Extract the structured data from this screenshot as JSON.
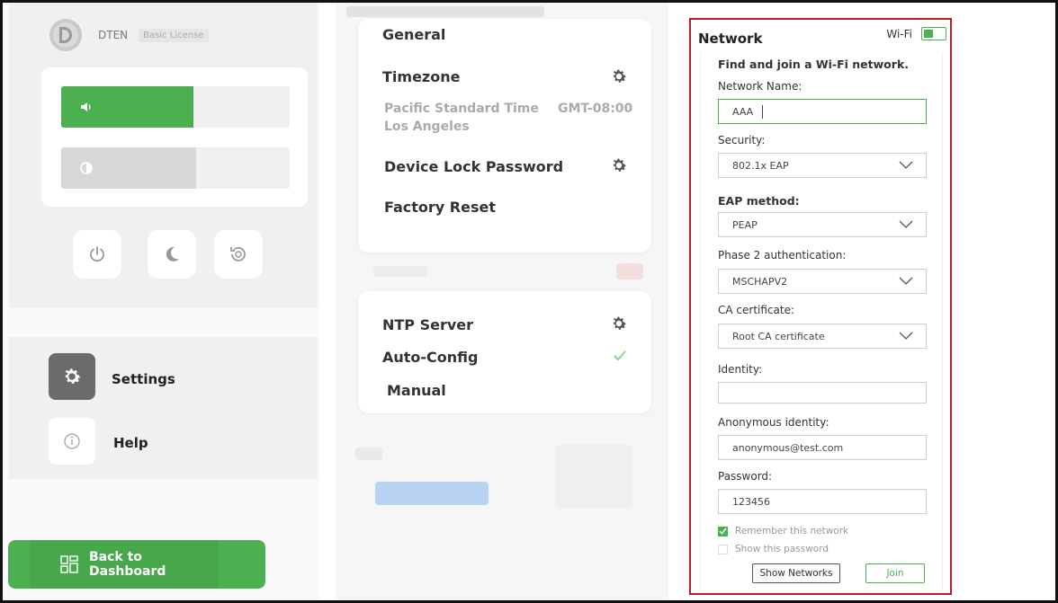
{
  "sidebar": {
    "brand": "DTEN",
    "license": "Basic License",
    "volume_level": 0.58,
    "brightness_level": 0.59,
    "nav": {
      "settings_label": "Settings",
      "help_label": "Help"
    },
    "back_label": "Back to Dashboard"
  },
  "middle": {
    "general": {
      "title": "General",
      "timezone_title": "Timezone",
      "timezone_name": "Pacific Standard Time",
      "timezone_city": "Los Angeles",
      "timezone_offset": "GMT-08:00",
      "device_lock_title": "Device Lock Password",
      "factory_reset_title": "Factory Reset"
    },
    "ntp": {
      "title": "NTP Server",
      "auto_label": "Auto-Config",
      "manual_label": "Manual"
    }
  },
  "network": {
    "title": "Network",
    "wifi_label": "Wi-Fi",
    "wifi_enabled": true,
    "find_heading": "Find and join a Wi-Fi network.",
    "network_name_label": "Network Name:",
    "network_name_value": "AAA",
    "security_label": "Security:",
    "security_value": "802.1x EAP",
    "eap_label": "EAP method:",
    "eap_value": "PEAP",
    "phase2_label": "Phase 2 authentication:",
    "phase2_value": "MSCHAPV2",
    "ca_label": "CA certificate:",
    "ca_value": "Root CA certificate",
    "identity_label": "Identity:",
    "identity_value": "",
    "anon_label": "Anonymous identity:",
    "anon_value": "anonymous@test.com",
    "password_label": "Password:",
    "password_value": "123456",
    "remember_label": "Remember this network",
    "remember_checked": true,
    "show_password_label": "Show this password",
    "show_password_checked": false,
    "show_networks_label": "Show Networks",
    "join_label": "Join"
  },
  "colors": {
    "accent_green": "#4caf50",
    "panel_border": "#b3202a"
  }
}
